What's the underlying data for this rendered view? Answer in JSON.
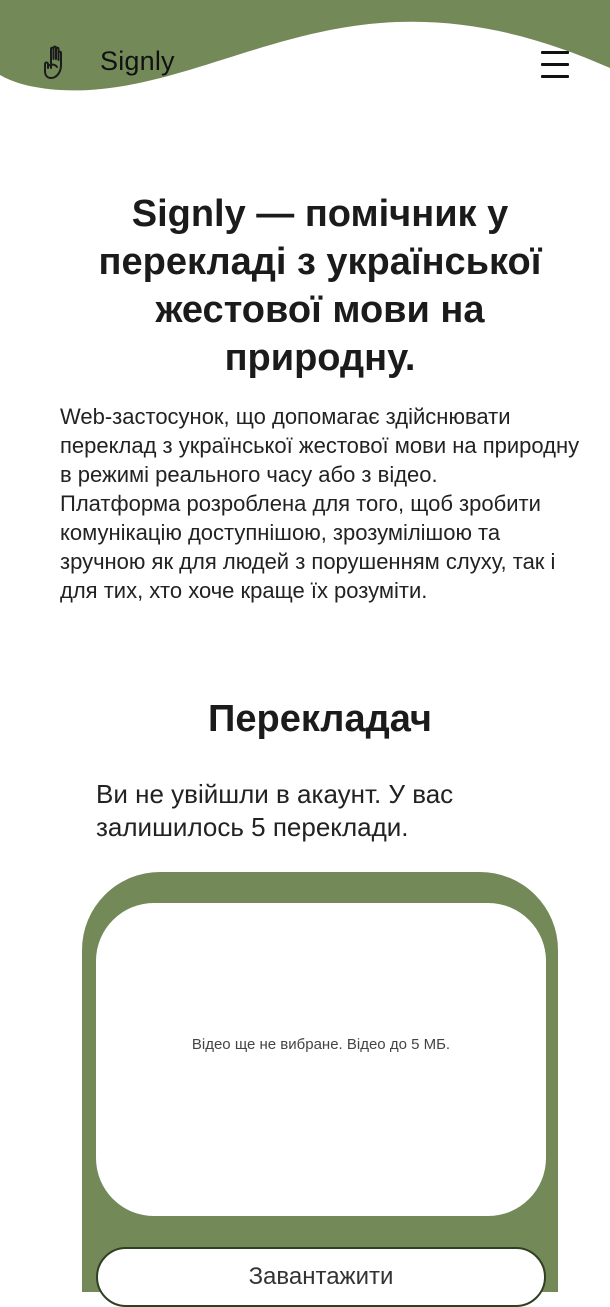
{
  "header": {
    "brand": "Signly",
    "logo_icon": "hand-sign-icon",
    "menu_icon": "hamburger-menu-icon"
  },
  "hero": {
    "title": "Signly — помічник у перекладі з української жестової мови на природну.",
    "description_1": "Web-застосунок, що допомагає здійснювати переклад з української жестової мови на природну в режимі реального часу або з відео.",
    "description_2": "Платформа розроблена для того, щоб зробити комунікацію доступнішою, зрозумілішою та зручною як для людей з порушенням слуху, так і для тих, хто хоче краще їх розуміти."
  },
  "translator": {
    "title": "Перекладач",
    "status": "Ви не увійшли в акаунт. У вас залишилось 5 переклади.",
    "video_placeholder": "Відео ще не вибране. Відео до 5 МБ.",
    "upload_label": "Завантажити"
  },
  "colors": {
    "accent_green": "#738a58",
    "text_dark": "#1b1b1b",
    "background": "#ffffff"
  }
}
